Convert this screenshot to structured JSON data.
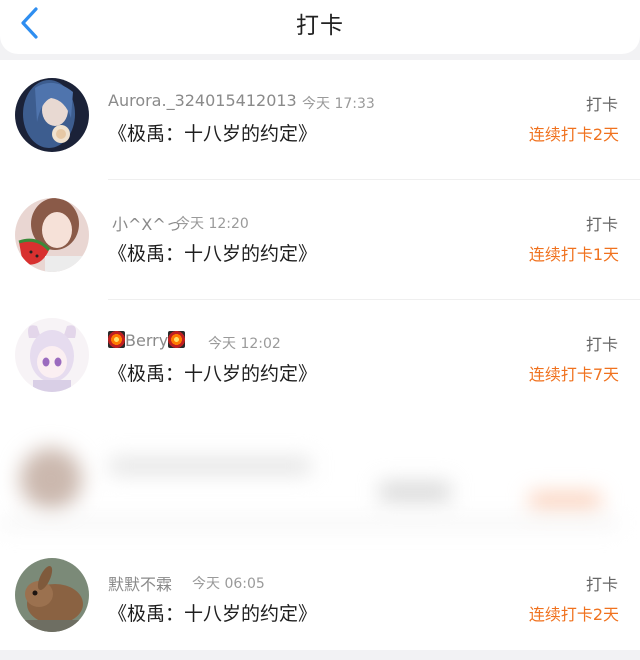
{
  "header": {
    "title": "打卡",
    "back_icon": "chevron-left-icon",
    "accent_color": "#2f8ef0"
  },
  "entries": [
    {
      "username": "Aurora._324015412013",
      "time": "今天 17:33",
      "book": "《极禹：十八岁的约定》",
      "action": "打卡",
      "streak": "连续打卡2天",
      "avatar": "avatar-blue-hair"
    },
    {
      "username": "小^X^っ",
      "time": "今天 12:20",
      "book": "《极禹：十八岁的约定》",
      "action": "打卡",
      "streak": "连续打卡1天",
      "avatar": "avatar-girl-watermelon"
    },
    {
      "username": "Berry",
      "time": "今天 12:02",
      "book": "《极禹：十八岁的约定》",
      "action": "打卡",
      "streak": "连续打卡7天",
      "avatar": "avatar-anime-character",
      "name_icon": "firework-emoji-icon"
    },
    {
      "username": "默默不霖",
      "time": "今天 06:05",
      "book": "《极禹：十八岁的约定》",
      "action": "打卡",
      "streak": "连续打卡2天",
      "avatar": "avatar-rabbit"
    }
  ],
  "colors": {
    "streak": "#f0721f",
    "username": "#8a8a8a",
    "book": "#1e1e1e"
  }
}
